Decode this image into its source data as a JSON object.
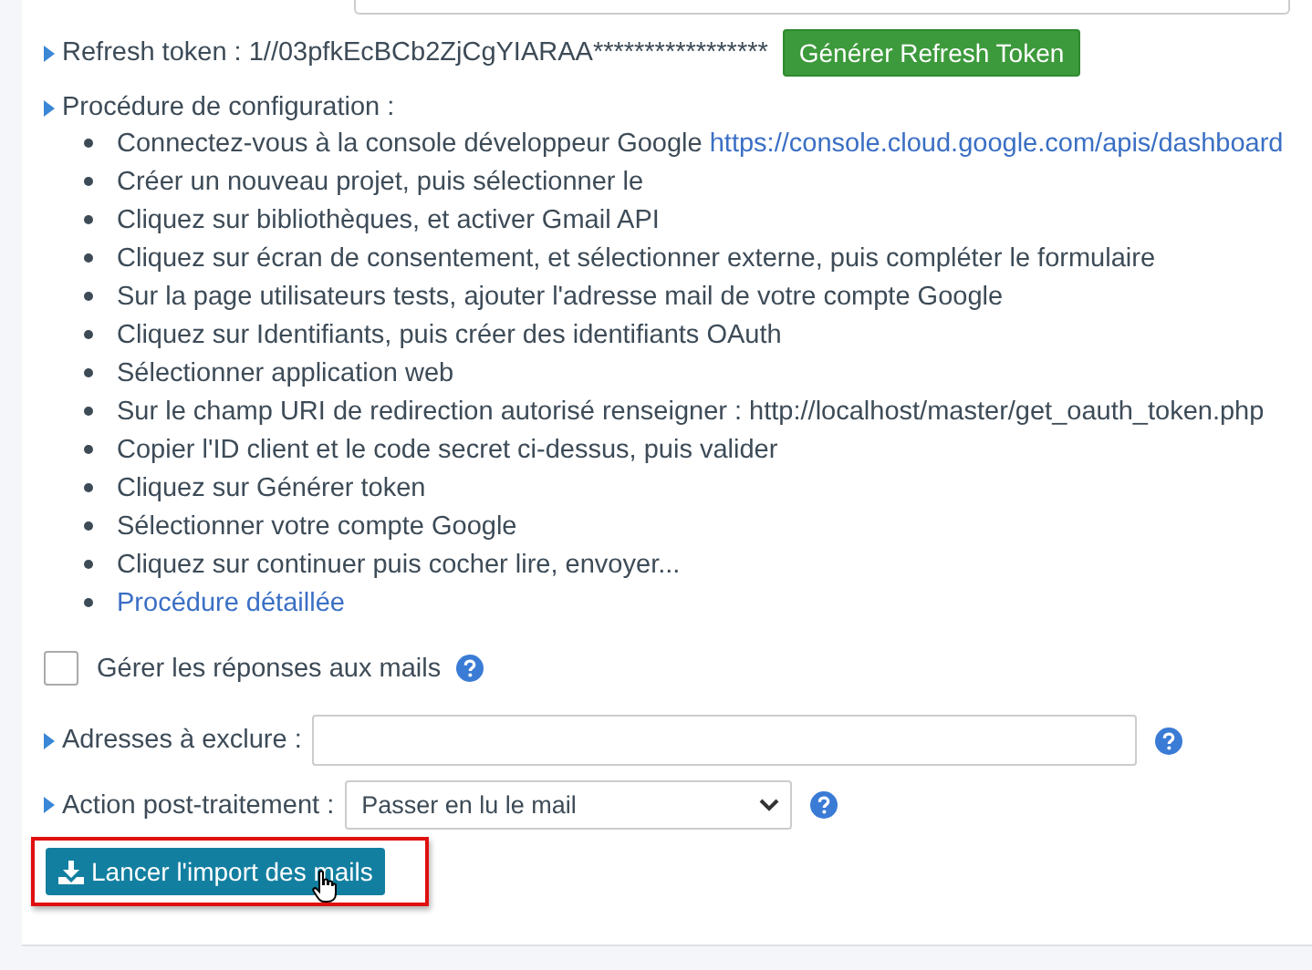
{
  "refresh_token": {
    "label": "Refresh token : 1//03pfkEcBCb2ZjCgYIARAA*****************",
    "button": "Générer Refresh Token"
  },
  "procedure": {
    "label": "Procédure de configuration :",
    "steps": [
      {
        "text": "Connectez-vous à la console développeur Google ",
        "link": "https://console.cloud.google.com/apis/dashboard"
      },
      {
        "text": "Créer un nouveau projet, puis sélectionner le"
      },
      {
        "text": "Cliquez sur bibliothèques, et activer Gmail API"
      },
      {
        "text": "Cliquez sur écran de consentement, et sélectionner externe, puis compléter le formulaire"
      },
      {
        "text": "Sur la page utilisateurs tests, ajouter l'adresse mail de votre compte Google"
      },
      {
        "text": "Cliquez sur Identifiants, puis créer des identifiants OAuth"
      },
      {
        "text": "Sélectionner application web"
      },
      {
        "text": "Sur le champ URI de redirection autorisé renseigner : http://localhost/master/get_oauth_token.php"
      },
      {
        "text": "Copier l'ID client et le code secret ci-dessus, puis valider"
      },
      {
        "text": "Cliquez sur Générer token"
      },
      {
        "text": "Sélectionner votre compte Google"
      },
      {
        "text": "Cliquez sur continuer puis cocher lire, envoyer..."
      },
      {
        "link": "Procédure détaillée"
      }
    ]
  },
  "manage_replies": {
    "label": "Gérer les réponses aux mails",
    "checked": false
  },
  "exclude": {
    "label": "Adresses à exclure :"
  },
  "post_action": {
    "label": "Action post-traitement :",
    "value": "Passer en lu le mail"
  },
  "import_button": "Lancer l'import des mails"
}
